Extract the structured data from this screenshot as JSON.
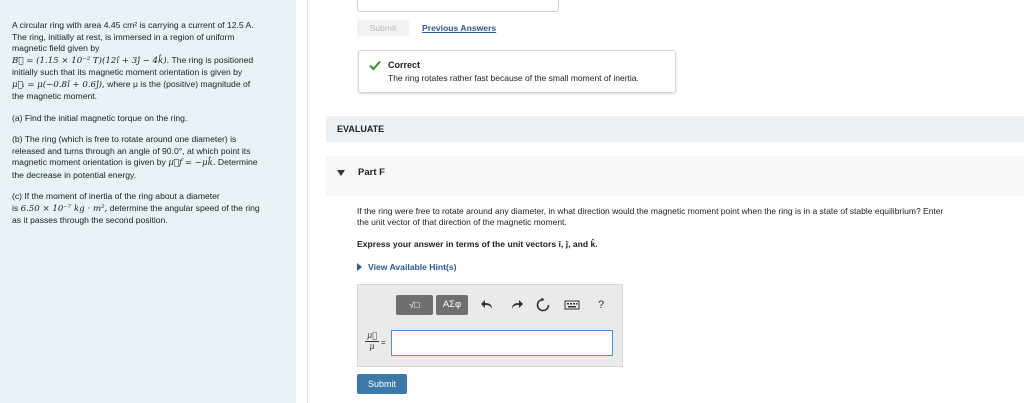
{
  "problem": {
    "intro_line1": "A circular ring with area 4.45 cm² is carrying a current of 12.5 A.",
    "intro_line2": "The ring, initially at rest, is immersed in a region of uniform",
    "intro_line3": "magnetic field given by",
    "field_expr": "B⃗ = (1.15 × 10⁻² T)(12î + 3ĵ − 4k̂).",
    "field_tail": " The ring is positioned",
    "moment_line1": "initially such that its magnetic moment orientation is given by",
    "moment_expr": "μ⃗ᵢ = μ(−0.8î + 0.6ĵ),",
    "moment_tail": " where μ is the (positive) magnitude of",
    "moment_line3": "the magnetic moment.",
    "part_a": "(a) Find the initial magnetic torque on the ring.",
    "part_b_1": "(b) The ring (which is free to rotate around one diameter) is",
    "part_b_2": "released and turns through an angle of 90.0°, at which point its",
    "part_b_3a": "magnetic moment orientation is given by ",
    "part_b_3expr": "μ⃗f = −μk̂.",
    "part_b_3b": " Determine",
    "part_b_4": "the decrease in potential energy.",
    "part_c_1": "(c) If the moment of inertia of the ring about a diameter",
    "part_c_2a": "is ",
    "part_c_2expr": "6.50 × 10⁻⁷ kg · m²,",
    "part_c_2b": " determine the angular speed of the ring",
    "part_c_3": "as it passes through the second position."
  },
  "previous": {
    "submit_label": "Submit",
    "previous_answers_label": "Previous Answers"
  },
  "feedback": {
    "title": "Correct",
    "message": "The ring rotates rather fast because of the small moment of inertia."
  },
  "evaluate_label": "EVALUATE",
  "part": {
    "label": "Part F",
    "question_line1": "If the ring were free to rotate around any diameter, in what direction would the magnetic moment point when the ring is in a state of stable equilibrium? Enter",
    "question_line2": "the unit vector of that direction of the magnetic moment.",
    "instruction": "Express your answer in terms of the unit vectors î, ĵ, and k̂.",
    "hint_label": "View Available Hint(s)"
  },
  "editor": {
    "templates_label": "√□",
    "greek_label": "ΑΣφ",
    "help_label": "?",
    "answer_label_num": "μ⃗",
    "answer_label_den": "μ",
    "answer_value": ""
  },
  "submit_label": "Submit",
  "colors": {
    "left_panel_bg": "#e6f3f7",
    "link": "#2b5a94",
    "correct_green": "#3a8a2e",
    "submit_bg": "#3b79a8"
  }
}
